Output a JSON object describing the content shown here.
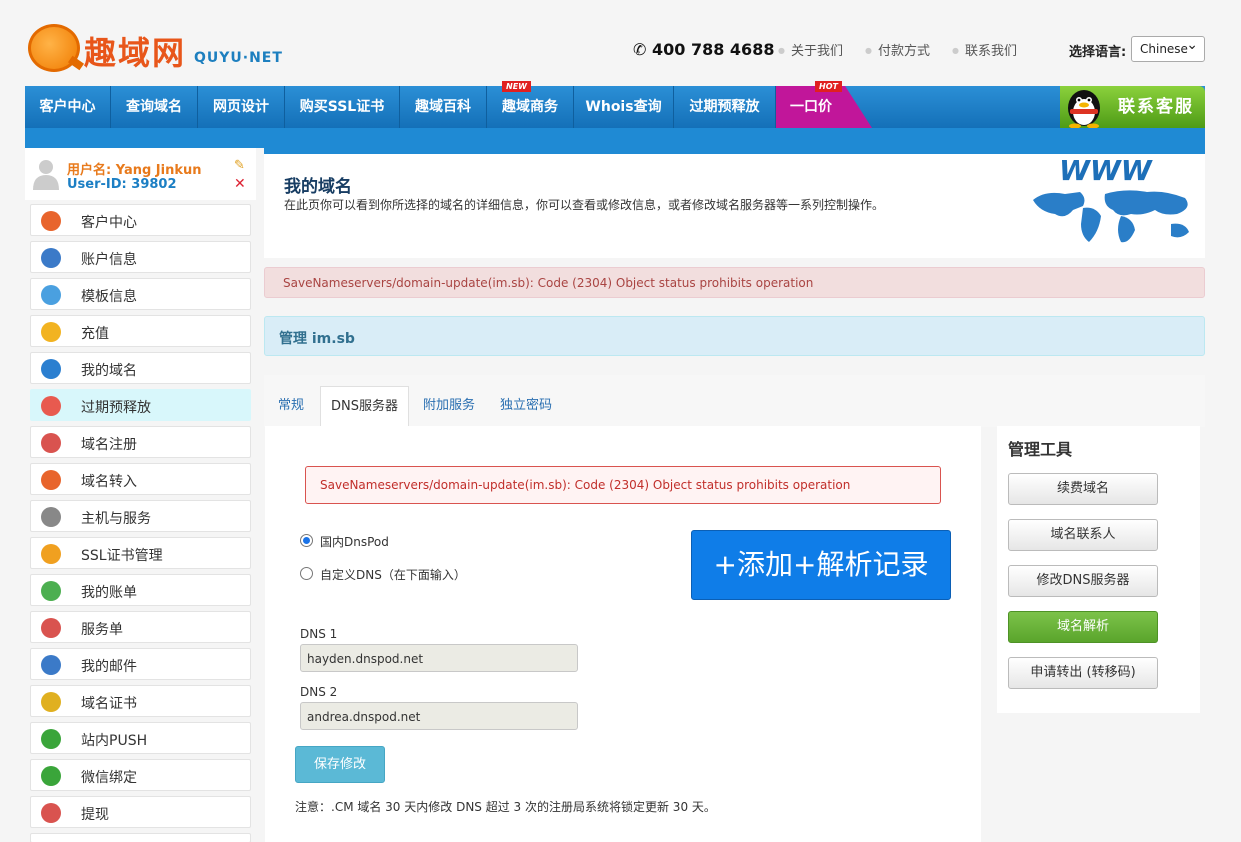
{
  "header": {
    "logo_cn": "趣域网",
    "logo_en": "QUYU·NET",
    "phone": "400 788 4688",
    "links": [
      "关于我们",
      "付款方式",
      "联系我们"
    ],
    "language_label": "选择语言:",
    "language_value": "Chinese"
  },
  "nav": {
    "items": [
      "客户中心",
      "查询域名",
      "网页设计",
      "购买SSL证书",
      "趣域百科",
      "趣域商务",
      "Whois查询",
      "过期预释放"
    ],
    "special": "一口价",
    "new_badge": "NEW",
    "hot_badge": "HOT",
    "service": "联系客服"
  },
  "user": {
    "name": "用户名: Yang Jinkun",
    "id": "User-ID: 39802"
  },
  "sidebar": {
    "items": [
      {
        "label": "客户中心",
        "icon": "home-icon",
        "color": "#e8642c"
      },
      {
        "label": "账户信息",
        "icon": "user-icon",
        "color": "#3b7ac8"
      },
      {
        "label": "模板信息",
        "icon": "template-icon",
        "color": "#4aa0e0"
      },
      {
        "label": "充值",
        "icon": "coin-icon",
        "color": "#f2b321"
      },
      {
        "label": "我的域名",
        "icon": "globe-icon",
        "color": "#2b7fd0"
      },
      {
        "label": "过期预释放",
        "icon": "list-icon",
        "color": "#e85a4f"
      },
      {
        "label": "域名注册",
        "icon": "cart-icon",
        "color": "#d9534f"
      },
      {
        "label": "域名转入",
        "icon": "transfer-icon",
        "color": "#e8642c"
      },
      {
        "label": "主机与服务",
        "icon": "server-icon",
        "color": "#888888"
      },
      {
        "label": "SSL证书管理",
        "icon": "ssl-icon",
        "color": "#f0a020"
      },
      {
        "label": "我的账单",
        "icon": "bill-icon",
        "color": "#4caf50"
      },
      {
        "label": "服务单",
        "icon": "ticket-icon",
        "color": "#d9534f"
      },
      {
        "label": "我的邮件",
        "icon": "mail-icon",
        "color": "#3b7ac8"
      },
      {
        "label": "域名证书",
        "icon": "certificate-icon",
        "color": "#e0b020"
      },
      {
        "label": "站内PUSH",
        "icon": "push-icon",
        "color": "#3aa53a"
      },
      {
        "label": "微信绑定",
        "icon": "wechat-icon",
        "color": "#3aa53a"
      },
      {
        "label": "提现",
        "icon": "withdraw-icon",
        "color": "#d9534f"
      }
    ]
  },
  "main": {
    "title": "我的域名",
    "description": "在此页你可以看到你所选择的域名的详细信息，你可以查看或修改信息，或者修改域名服务器等一系列控制操作。",
    "error": "SaveNameservers/domain-update(im.sb): Code (2304) Object status prohibits operation",
    "manage": "管理 im.sb",
    "tabs": [
      "常规",
      "DNS服务器",
      "附加服务",
      "独立密码"
    ],
    "active_tab": "DNS服务器",
    "radio_dnspod": "国内DnsPod",
    "radio_custom": "自定义DNS（在下面输入）",
    "add_button": "+添加+解析记录",
    "dns1_label": "DNS 1",
    "dns1_value": "hayden.dnspod.net",
    "dns2_label": "DNS 2",
    "dns2_value": "andrea.dnspod.net",
    "save_button": "保存修改",
    "note": "注意：.CM 域名 30 天内修改 DNS 超过 3 次的注册局系统将锁定更新 30 天。"
  },
  "tools": {
    "title": "管理工具",
    "buttons": [
      "续费域名",
      "域名联系人",
      "修改DNS服务器",
      "域名解析",
      "申请转出 (转移码)"
    ]
  }
}
